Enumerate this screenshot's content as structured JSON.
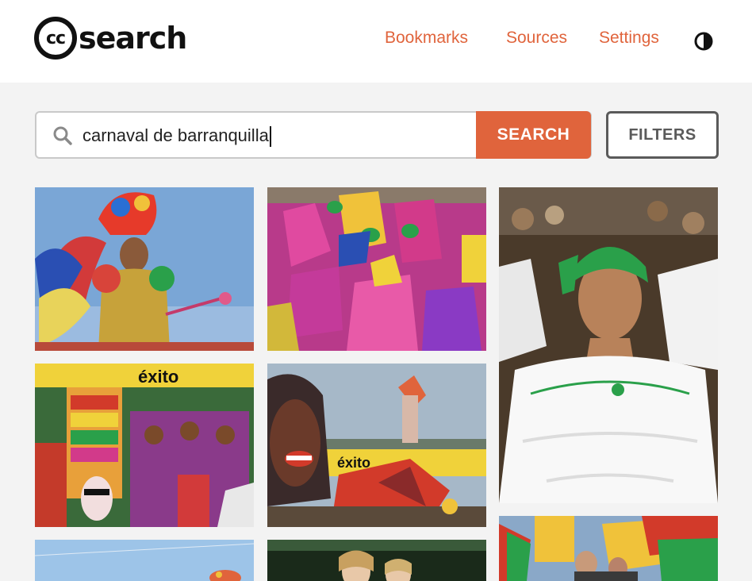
{
  "header": {
    "logo_cc": "cc",
    "logo_text": "search",
    "nav": {
      "bookmarks": "Bookmarks",
      "sources": "Sources",
      "settings": "Settings"
    },
    "theme_icon": "contrast-icon"
  },
  "search": {
    "query": "carnaval de barranquilla",
    "search_label": "SEARCH",
    "filters_label": "FILTERS",
    "icon": "search-icon"
  },
  "colors": {
    "accent": "#e0643c",
    "background": "#f3f3f3",
    "header": "#ffffff"
  },
  "results": [
    {
      "name": "result-image-1",
      "subject": "dancer in feathered headdress"
    },
    {
      "name": "result-image-2",
      "subject": "masked dancers in pink costumes"
    },
    {
      "name": "result-image-3",
      "subject": "woman in green headscarf and white dress"
    },
    {
      "name": "result-image-4",
      "subject": "fruit hat parade float"
    },
    {
      "name": "result-image-5",
      "subject": "giant mask float with exito banners"
    },
    {
      "name": "result-image-6",
      "subject": "colorful costume against sky"
    },
    {
      "name": "result-image-7",
      "subject": "women smiling in crowd"
    },
    {
      "name": "result-image-8",
      "subject": "flags at parade"
    }
  ],
  "banners": {
    "exito": "éxito"
  }
}
